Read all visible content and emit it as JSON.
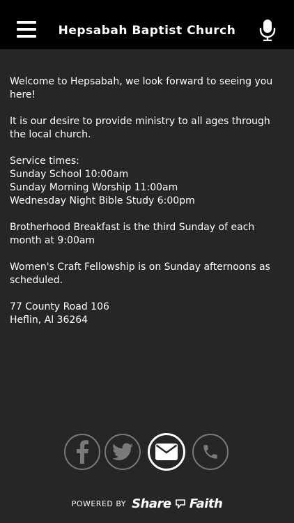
{
  "header": {
    "title": "Hepsabah Baptist Church",
    "menu_icon": "hamburger-menu-icon",
    "mic_icon": "microphone-icon"
  },
  "content": {
    "welcome": "Welcome to Hepsabah, we look forward to seeing you here!",
    "desire": "It is our desire to provide ministry to all ages through the local church.",
    "service_heading": "Service times:",
    "service_1": "Sunday School 10:00am",
    "service_2": "Sunday Morning Worship 11:00am",
    "service_3": "Wednesday Night Bible Study 6:00pm",
    "brotherhood": "Brotherhood Breakfast is the third Sunday of each month at 9:00am",
    "womens": "Women's Craft Fellowship is on Sunday afternoons as scheduled.",
    "address_1": "77 County Road 106",
    "address_2": "Heflin, Al 36264"
  },
  "social": {
    "facebook_icon": "facebook-icon",
    "twitter_icon": "twitter-icon",
    "email_icon": "envelope-icon",
    "phone_icon": "phone-icon"
  },
  "footer": {
    "powered_by": "POWERED BY",
    "brand_left": "Share",
    "brand_right": "Faith"
  },
  "colors": {
    "header_bg": "#000000",
    "page_bg": "#262626",
    "text": "#ffffff",
    "icon_gray": "#7a7a7a"
  }
}
